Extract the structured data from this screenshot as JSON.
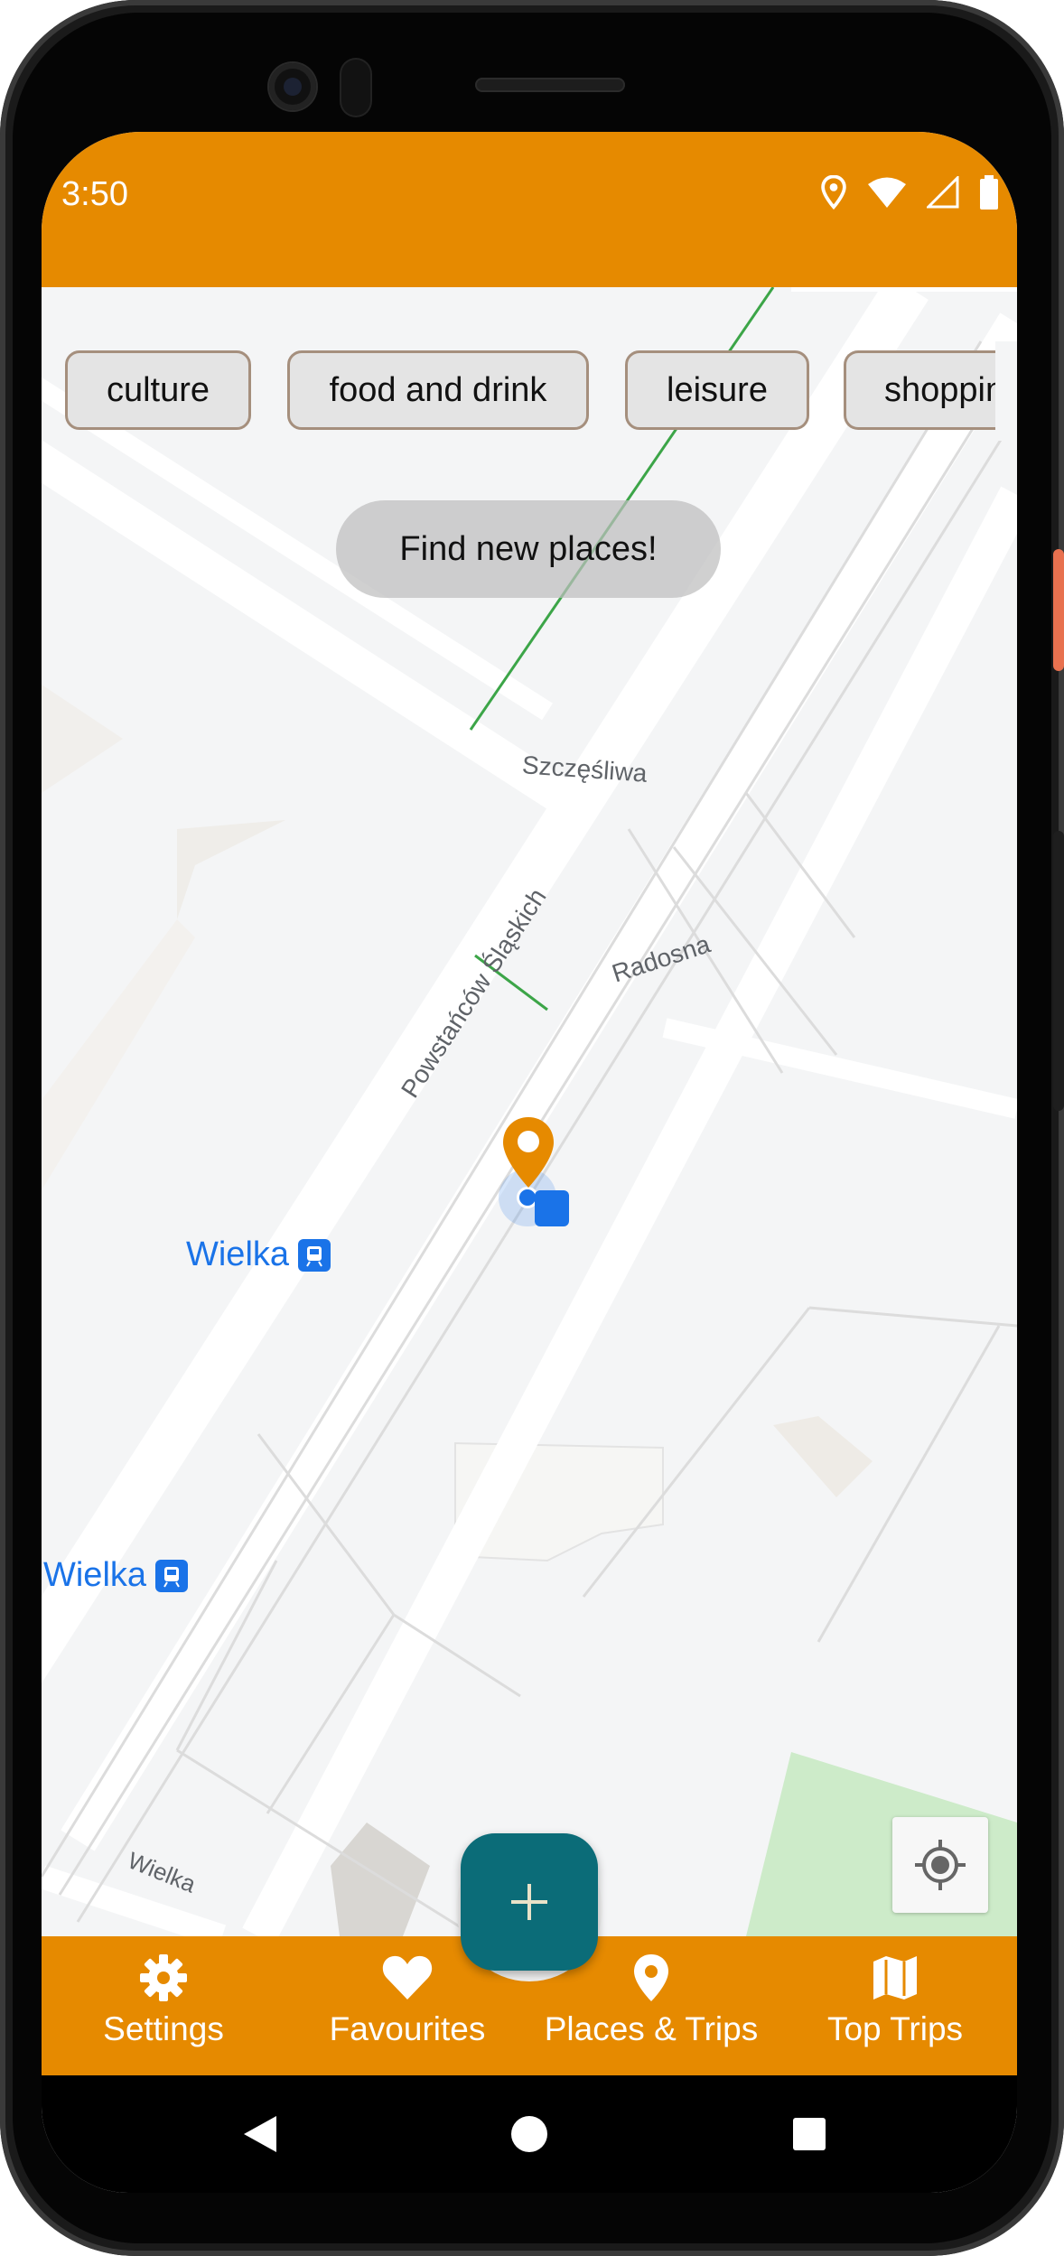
{
  "status_bar": {
    "time": "3:50",
    "icons": [
      "location-icon",
      "wifi-icon",
      "signal-icon",
      "battery-icon"
    ],
    "background": "#e68a00"
  },
  "categories": [
    {
      "label": "culture"
    },
    {
      "label": "food and drink"
    },
    {
      "label": "leisure"
    },
    {
      "label": "shopping"
    }
  ],
  "find_button": {
    "label": "Find new places!"
  },
  "map": {
    "street_labels": {
      "szczesliwa": "Szczęśliwa",
      "radosna": "Radosna",
      "powstancow": "Powstańców Śląskich",
      "wielka_street": "Wielka"
    },
    "transit_stops": [
      {
        "label": "Wielka"
      },
      {
        "label": "Wielka"
      }
    ]
  },
  "fab": {
    "icon": "plus-icon",
    "color": "#0b6c78"
  },
  "bottom_nav": {
    "background": "#e68a00",
    "items": [
      {
        "label": "Settings",
        "icon": "gear-icon"
      },
      {
        "label": "Favourites",
        "icon": "heart-icon"
      },
      {
        "label": "Places & Trips",
        "icon": "map-pin-icon"
      },
      {
        "label": "Top Trips",
        "icon": "map-icon"
      }
    ]
  },
  "system_nav": {
    "buttons": [
      "back-icon",
      "home-icon",
      "recents-icon"
    ]
  }
}
